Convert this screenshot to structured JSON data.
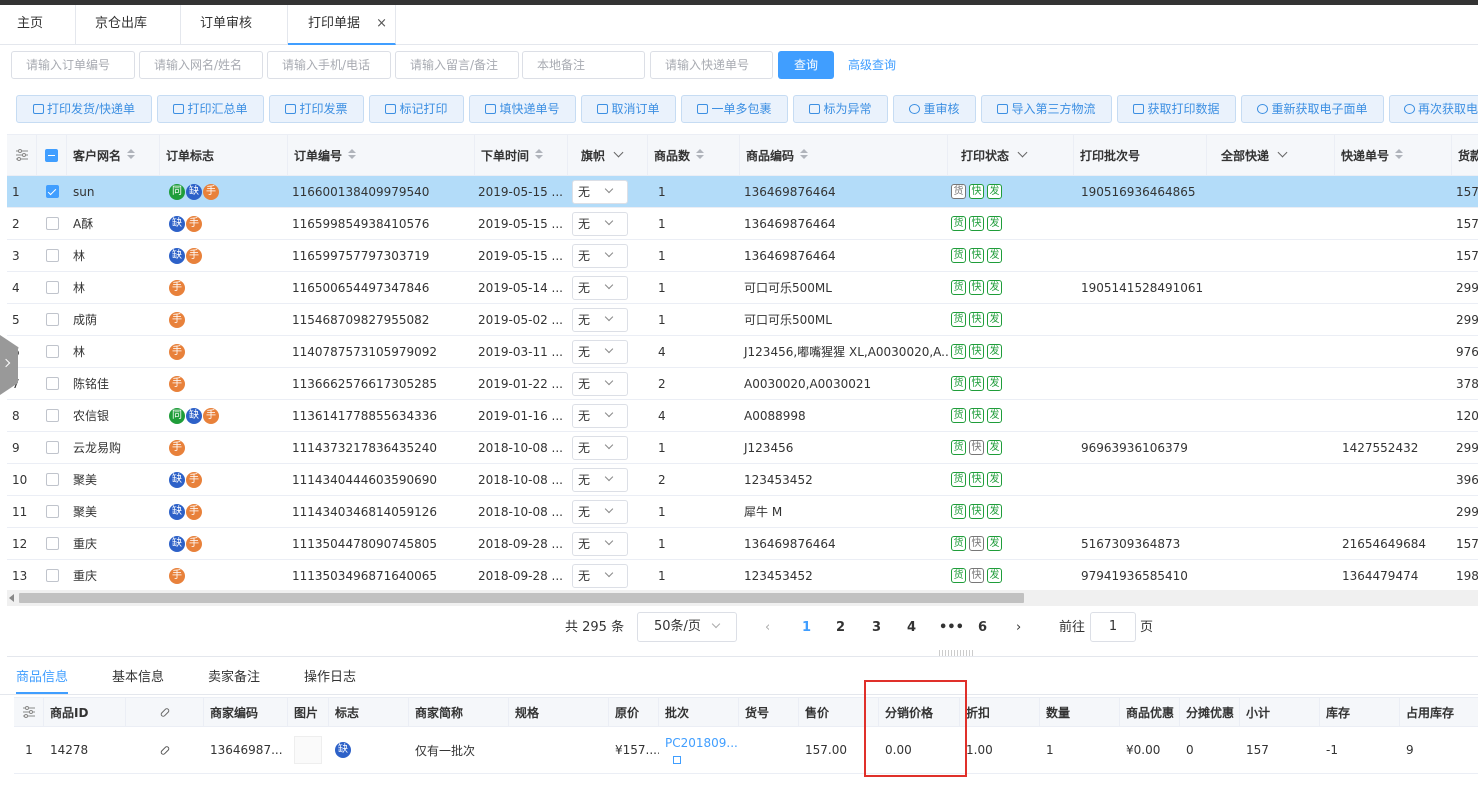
{
  "tabs": [
    {
      "label": "主页"
    },
    {
      "label": "京仓出库"
    },
    {
      "label": "订单审核"
    },
    {
      "label": "打印单据",
      "close": "×"
    }
  ],
  "filters": {
    "order_no": "请输入订单编号",
    "name": "请输入网名/姓名",
    "phone": "请输入手机/电话",
    "remark": "请输入留言/备注",
    "local_remark": "本地备注",
    "express_no": "请输入快递单号",
    "query": "查询",
    "advanced": "高级查询"
  },
  "toolbar": [
    "打印发货/快递单",
    "打印汇总单",
    "打印发票",
    "标记打印",
    "填快递单号",
    "取消订单",
    "一单多包裹",
    "标为异常",
    "重审核",
    "导入第三方物流",
    "获取打印数据",
    "重新获取电子面单",
    "再次获取电"
  ],
  "grid": {
    "headers": {
      "customer": "客户网名",
      "flag": "订单标志",
      "order_no": "订单编号",
      "time": "下单时间",
      "banner": "旗帜",
      "qty": "商品数",
      "code": "商品编码",
      "print_status": "打印状态",
      "batch": "打印批次号",
      "express": "全部快递",
      "express_no": "快递单号",
      "amount": "货款"
    },
    "rows": [
      {
        "n": "1",
        "checked": true,
        "customer": "sun",
        "flags": [
          "同",
          "缺",
          "手"
        ],
        "order_no": "116600138409979540",
        "time": "2019-05-15 ...",
        "banner": "无",
        "qty": "1",
        "code": "136469876464",
        "ps": [
          "g",
          "快",
          "发"
        ],
        "batch": "190516936464865",
        "express_no": "",
        "amount": "157"
      },
      {
        "n": "2",
        "checked": false,
        "customer": "A酥",
        "flags": [
          "缺",
          "手"
        ],
        "order_no": "116599854938410576",
        "time": "2019-05-15 ...",
        "banner": "无",
        "qty": "1",
        "code": "136469876464",
        "ps": [
          "货",
          "快",
          "发"
        ],
        "batch": "",
        "express_no": "",
        "amount": "157"
      },
      {
        "n": "3",
        "checked": false,
        "customer": "林",
        "flags": [
          "缺",
          "手"
        ],
        "order_no": "116599757797303719",
        "time": "2019-05-15 ...",
        "banner": "无",
        "qty": "1",
        "code": "136469876464",
        "ps": [
          "货",
          "快",
          "发"
        ],
        "batch": "",
        "express_no": "",
        "amount": "157"
      },
      {
        "n": "4",
        "checked": false,
        "customer": "林",
        "flags": [
          "手"
        ],
        "order_no": "116500654497347846",
        "time": "2019-05-14 ...",
        "banner": "无",
        "qty": "1",
        "code": "可口可乐500ML",
        "ps": [
          "货",
          "快",
          "发"
        ],
        "batch": "1905141528491061",
        "express_no": "",
        "amount": "299"
      },
      {
        "n": "5",
        "checked": false,
        "customer": "成荫",
        "flags": [
          "手"
        ],
        "order_no": "115468709827955082",
        "time": "2019-05-02 ...",
        "banner": "无",
        "qty": "1",
        "code": "可口可乐500ML",
        "ps": [
          "货",
          "快",
          "发"
        ],
        "batch": "",
        "express_no": "",
        "amount": "299"
      },
      {
        "n": "6",
        "checked": false,
        "customer": "林",
        "flags": [
          "手"
        ],
        "order_no": "114078757310597909​2",
        "time": "2019-03-11 ...",
        "banner": "无",
        "qty": "4",
        "code": "J123456,嘟嘴猩猩 XL,A0030020,A...",
        "ps": [
          "货",
          "快",
          "发"
        ],
        "batch": "",
        "express_no": "",
        "amount": "976"
      },
      {
        "n": "7",
        "checked": false,
        "customer": "陈铭佳",
        "flags": [
          "手"
        ],
        "order_no": "113666257661730528​5",
        "time": "2019-01-22 ...",
        "banner": "无",
        "qty": "2",
        "code": "A0030020,A0030021",
        "ps": [
          "货",
          "快",
          "发"
        ],
        "batch": "",
        "express_no": "",
        "amount": "378"
      },
      {
        "n": "8",
        "checked": false,
        "customer": "农信银",
        "flags": [
          "同",
          "缺",
          "手"
        ],
        "order_no": "113614177885563433​6",
        "time": "2019-01-16 ...",
        "banner": "无",
        "qty": "4",
        "code": "A0088998",
        "ps": [
          "货",
          "快",
          "发"
        ],
        "batch": "",
        "express_no": "",
        "amount": "120"
      },
      {
        "n": "9",
        "checked": false,
        "customer": "云龙易购",
        "flags": [
          "手"
        ],
        "order_no": "111437321783643524​0",
        "time": "2018-10-08 ...",
        "banner": "无",
        "qty": "1",
        "code": "J123456",
        "ps": [
          "货",
          "g",
          "发"
        ],
        "batch": "96963936106379",
        "express_no": "1427552432",
        "amount": "299"
      },
      {
        "n": "10",
        "checked": false,
        "customer": "聚美",
        "flags": [
          "缺",
          "手"
        ],
        "order_no": "111434044460359069​0",
        "time": "2018-10-08 ...",
        "banner": "无",
        "qty": "2",
        "code": "123453452",
        "ps": [
          "货",
          "快",
          "发"
        ],
        "batch": "",
        "express_no": "",
        "amount": "396"
      },
      {
        "n": "11",
        "checked": false,
        "customer": "聚美",
        "flags": [
          "缺",
          "手"
        ],
        "order_no": "111434034681405912​6",
        "time": "2018-10-08 ...",
        "banner": "无",
        "qty": "1",
        "code": "犀牛 M",
        "ps": [
          "货",
          "快",
          "发"
        ],
        "batch": "",
        "express_no": "",
        "amount": "299"
      },
      {
        "n": "12",
        "checked": false,
        "customer": "重庆",
        "flags": [
          "缺",
          "手"
        ],
        "order_no": "111350447809074580​5",
        "time": "2018-09-28 ...",
        "banner": "无",
        "qty": "1",
        "code": "136469876464",
        "ps": [
          "货",
          "g",
          "发"
        ],
        "batch": "5167309364873",
        "express_no": "21654649684",
        "amount": "157"
      },
      {
        "n": "13",
        "checked": false,
        "customer": "重庆",
        "flags": [
          "手"
        ],
        "order_no": "111350349687164006​5",
        "time": "2018-09-28 ...",
        "banner": "无",
        "qty": "1",
        "code": "123453452",
        "ps": [
          "货",
          "g",
          "发"
        ],
        "batch": "97941936585410",
        "express_no": "1364479474",
        "amount": "198"
      }
    ]
  },
  "pager": {
    "total": "共 295 条",
    "size": "50条/页",
    "pages": [
      "1",
      "2",
      "3",
      "4",
      "•••",
      "6"
    ],
    "goto": "前往",
    "goto_val": "1",
    "page_unit": "页"
  },
  "bottom_tabs": [
    "商品信息",
    "基本信息",
    "卖家备注",
    "操作日志"
  ],
  "bgrid": {
    "headers": [
      "商品ID",
      "",
      "商家编码",
      "图片",
      "标志",
      "商家简称",
      "规格",
      "原价",
      "批次",
      "货号",
      "售价",
      "分销价格",
      "折扣",
      "数量",
      "商品优惠",
      "分摊优惠",
      "小计",
      "库存",
      "占用库存"
    ],
    "row": {
      "n": "1",
      "id": "14278",
      "code": "13646987...",
      "flag": "缺",
      "short": "仅有一批次",
      "spec": "",
      "price": "¥157....",
      "batch": "PC201809...",
      "sku": "",
      "sale": "157.00",
      "dist": "0.00",
      "disc": "1.00",
      "qty": "1",
      "promo": "¥0.00",
      "share": "0",
      "subtotal": "157",
      "stock": "-1",
      "occupied": "9"
    }
  }
}
